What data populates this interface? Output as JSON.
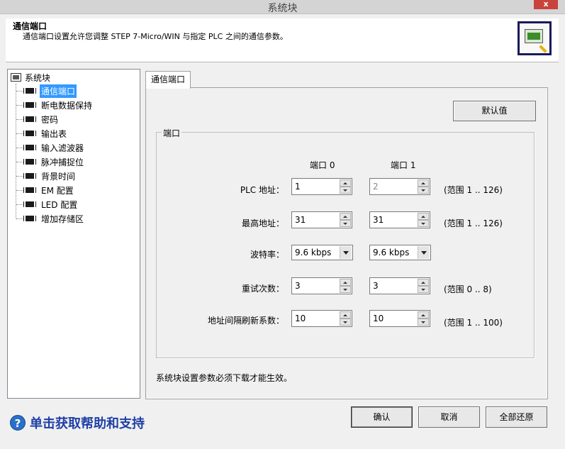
{
  "window": {
    "title": "系统块",
    "close_label": "x"
  },
  "header": {
    "title": "通信端口",
    "description": "通信端口设置允许您调整 STEP 7-Micro/WIN 与指定 PLC 之间的通信参数。"
  },
  "tree": {
    "root": "系统块",
    "items": [
      {
        "label": "通信端口",
        "selected": true
      },
      {
        "label": "断电数据保持"
      },
      {
        "label": "密码"
      },
      {
        "label": "输出表"
      },
      {
        "label": "输入滤波器"
      },
      {
        "label": "脉冲捕捉位"
      },
      {
        "label": "背景时间"
      },
      {
        "label": "EM 配置"
      },
      {
        "label": "LED 配置"
      },
      {
        "label": "增加存储区"
      }
    ]
  },
  "tab": {
    "label": "通信端口"
  },
  "buttons": {
    "default_values": "默认值",
    "ok": "确认",
    "cancel": "取消",
    "restore_all": "全部还原"
  },
  "group": {
    "legend": "端口",
    "port0_header": "端口 0",
    "port1_header": "端口 1",
    "rows": [
      {
        "label": "PLC 地址：",
        "port0": "1",
        "port1": "2",
        "range": "(范围 1 .. 126)"
      },
      {
        "label": "最高地址：",
        "port0": "31",
        "port1": "31",
        "range": "(范围 1 .. 126)"
      },
      {
        "label": "波特率：",
        "port0": "9.6 kbps",
        "port1": "9.6 kbps",
        "range": ""
      },
      {
        "label": "重试次数：",
        "port0": "3",
        "port1": "3",
        "range": "(范围 0 .. 8)"
      },
      {
        "label": "地址间隔刷新系数：",
        "port0": "10",
        "port1": "10",
        "range": "(范围 1 .. 100)"
      }
    ]
  },
  "note": "系统块设置参数必须下载才能生效。",
  "help": {
    "icon": "?",
    "text": "单击获取帮助和支持"
  }
}
